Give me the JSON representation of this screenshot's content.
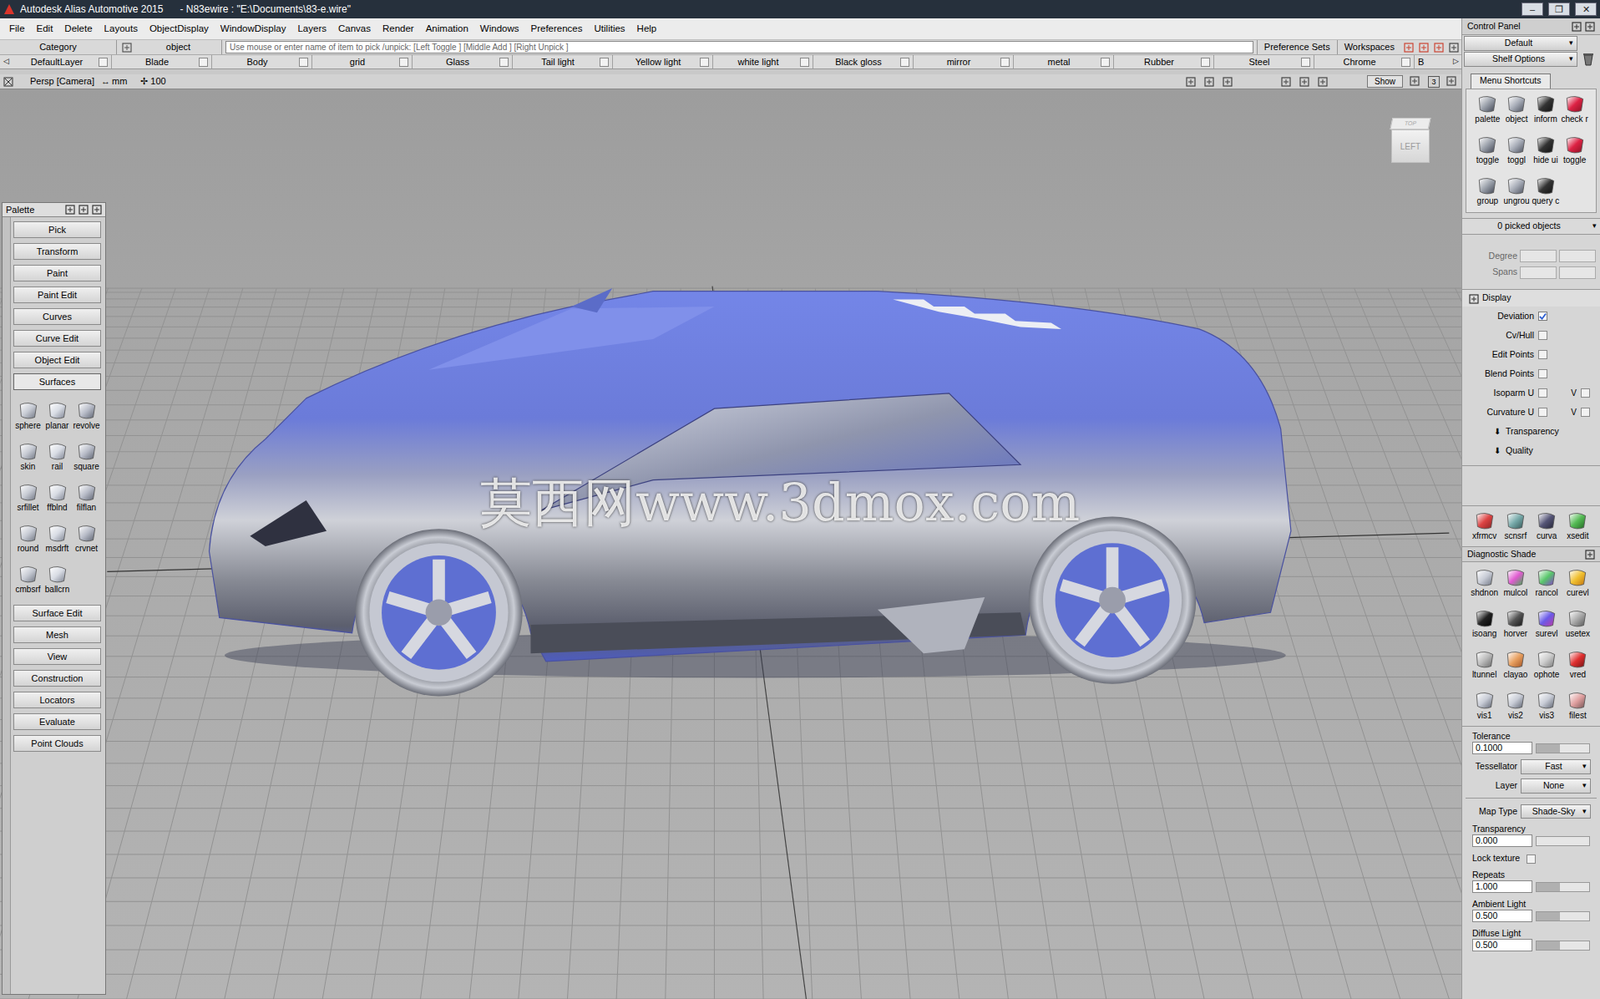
{
  "window": {
    "title": "Autodesk Alias Automotive 2015",
    "file": "- N83ewire : \"E:\\Documents\\83-e.wire\"",
    "controls": [
      "–",
      "❐",
      "✕"
    ]
  },
  "menu": [
    "File",
    "Edit",
    "Delete",
    "Layouts",
    "ObjectDisplay",
    "WindowDisplay",
    "Layers",
    "Canvas",
    "Render",
    "Animation",
    "Windows",
    "Preferences",
    "Utilities",
    "Help"
  ],
  "command_bar": {
    "category": "Category",
    "object": "object",
    "prompt": "Use mouse or enter name of item to pick /unpick: [Left Toggle ] [Middle Add ] [Right Unpick ]",
    "buttons": [
      "Preference Sets",
      "Workspaces"
    ]
  },
  "layer_bar": {
    "left_arrow": "◁",
    "right_arrow": "▷",
    "layers": [
      {
        "name": "DefaultLayer",
        "checked": false
      },
      {
        "name": "Blade",
        "checked": false
      },
      {
        "name": "Body",
        "checked": false
      },
      {
        "name": "grid",
        "checked": false
      },
      {
        "name": "Glass",
        "checked": false
      },
      {
        "name": "Tail light",
        "checked": false
      },
      {
        "name": "Yellow light",
        "checked": false
      },
      {
        "name": "white light",
        "checked": false
      },
      {
        "name": "Black gloss",
        "checked": false
      },
      {
        "name": "mirror",
        "checked": false
      },
      {
        "name": "metal",
        "checked": false
      },
      {
        "name": "Rubber",
        "checked": false
      },
      {
        "name": "Steel",
        "checked": false
      },
      {
        "name": "Chrome",
        "checked": false
      },
      {
        "name": "B",
        "checked": false
      }
    ]
  },
  "viewport": {
    "camera": "Persp [Camera]",
    "units_icon": "↔",
    "units": "mm",
    "grid_icon": "✢",
    "grid": "100",
    "show": "Show",
    "count": "3",
    "view_cube": {
      "top": "TOP",
      "side": "LEFT"
    },
    "watermark": "莫西网www.3dmox.com"
  },
  "palette": {
    "title": "Palette",
    "buttons_above": [
      "Pick",
      "Transform",
      "Paint",
      "Paint Edit",
      "Curves",
      "Curve Edit",
      "Object Edit"
    ],
    "section": {
      "label": "Surfaces",
      "expanded": true,
      "tools": [
        "sphere",
        "planar",
        "revolve",
        "skin",
        "rail",
        "square",
        "srfillet",
        "ffblnd",
        "filflan",
        "round",
        "msdrft",
        "crvnet",
        "cmbsrf",
        "ballcrn"
      ]
    },
    "buttons_below": [
      "Surface Edit",
      "Mesh",
      "View",
      "Construction",
      "Locators",
      "Evaluate",
      "Point Clouds"
    ]
  },
  "control_panel": {
    "title": "Control Panel",
    "arrow": "▾",
    "preset": "Default",
    "shelf_options": "Shelf Options",
    "tab": {
      "label": "Menu Shortcuts",
      "selected": true
    },
    "shortcuts": [
      "palette",
      "object",
      "inform",
      "check r",
      "toggle",
      "toggl",
      "hide ui",
      "toggle",
      "group",
      "ungrou",
      "query c"
    ],
    "picked": "0 picked objects",
    "degree": "Degree",
    "spans": "Spans",
    "display": {
      "label": "Display",
      "rows": [
        {
          "label": "Deviation",
          "checked": true
        },
        {
          "label": "Cv/Hull",
          "checked": false
        },
        {
          "label": "Edit Points",
          "checked": false
        },
        {
          "label": "Blend Points",
          "checked": false
        },
        {
          "label": "Isoparm U",
          "checked": false,
          "v_label": "V",
          "v_checked": false
        },
        {
          "label": "Curvature U",
          "checked": false,
          "v_label": "V",
          "v_checked": false
        }
      ],
      "subsections": [
        {
          "label": "Transparency",
          "icon": "⬇",
          "expanded": false
        },
        {
          "label": "Quality",
          "icon": "⬇",
          "expanded": false
        }
      ]
    },
    "shelf": [
      "xfrmcv",
      "scnsrf",
      "curva",
      "xsedit"
    ],
    "diagnostic": {
      "title": "Diagnostic Shade",
      "tools": [
        "shdnon",
        "mulcol",
        "rancol",
        "curevl",
        "isoang",
        "horver",
        "surevl",
        "usetex",
        "ltunnel",
        "clayao",
        "ophote",
        "vred",
        "vis1",
        "vis2",
        "vis3",
        "filest"
      ],
      "tolerance": {
        "label": "Tolerance",
        "value": "0.1000",
        "level": 0.45
      },
      "tessellator": {
        "label": "Tessellator",
        "value": "Fast"
      },
      "layer": {
        "label": "Layer",
        "value": "None"
      },
      "map_type": {
        "label": "Map Type",
        "value": "Shade-Sky"
      },
      "transparency": {
        "label": "Transparency",
        "value": "0.000",
        "level": 0
      },
      "lock_texture": {
        "label": "Lock texture",
        "checked": false
      },
      "repeats": {
        "label": "Repeats",
        "value": "1.000",
        "level": 0.45
      },
      "ambient": {
        "label": "Ambient Light",
        "value": "0.500",
        "level": 0.45
      },
      "diffuse": {
        "label": "Diffuse Light",
        "value": "0.500",
        "level": 0.45
      }
    }
  }
}
